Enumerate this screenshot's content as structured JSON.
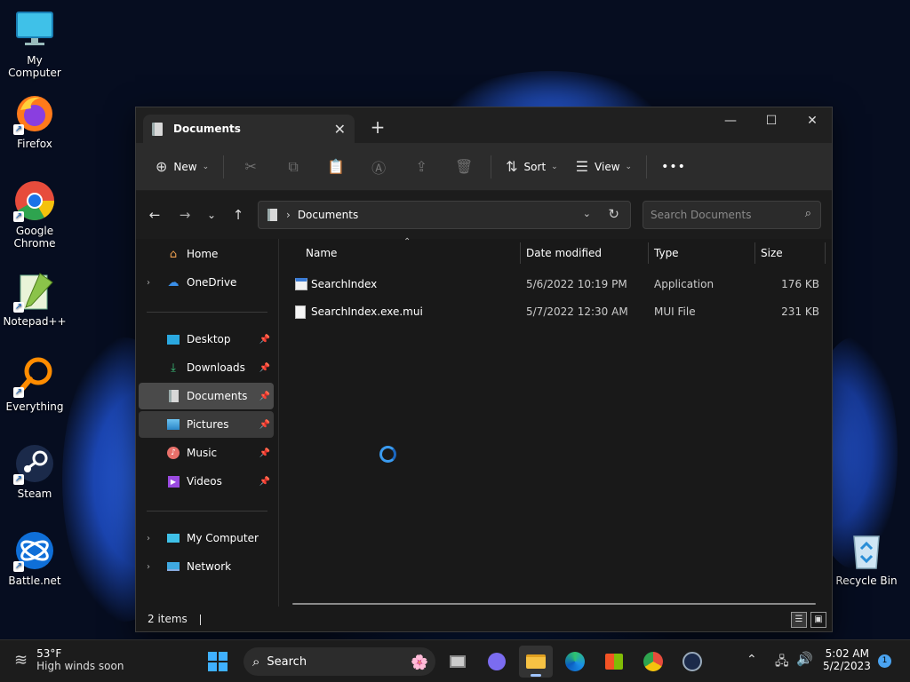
{
  "desktop_icons": [
    {
      "label": "My Computer",
      "icon": "monitor-icon"
    },
    {
      "label": "Firefox",
      "icon": "firefox-icon"
    },
    {
      "label": "Google Chrome",
      "icon": "chrome-icon"
    },
    {
      "label": "Notepad++",
      "icon": "notepadpp-icon"
    },
    {
      "label": "Everything",
      "icon": "everything-icon"
    },
    {
      "label": "Steam",
      "icon": "steam-icon"
    },
    {
      "label": "Battle.net",
      "icon": "battlenet-icon"
    },
    {
      "label": "Recycle Bin",
      "icon": "recycle-bin-icon"
    }
  ],
  "explorer": {
    "tab_title": "Documents",
    "toolbar": {
      "new_label": "New",
      "sort_label": "Sort",
      "view_label": "View",
      "more_label": "•••"
    },
    "address": {
      "crumb": "Documents",
      "sep": "›"
    },
    "search": {
      "placeholder": "Search Documents"
    },
    "sidebar": {
      "home": "Home",
      "onedrive": "OneDrive",
      "desktop": "Desktop",
      "downloads": "Downloads",
      "documents": "Documents",
      "pictures": "Pictures",
      "music": "Music",
      "videos": "Videos",
      "mycomputer": "My Computer",
      "network": "Network"
    },
    "columns": {
      "name": "Name",
      "date": "Date modified",
      "type": "Type",
      "size": "Size"
    },
    "files": [
      {
        "name": "SearchIndex",
        "date": "5/6/2022 10:19 PM",
        "type": "Application",
        "size": "176 KB"
      },
      {
        "name": "SearchIndex.exe.mui",
        "date": "5/7/2022 12:30 AM",
        "type": "MUI File",
        "size": "231 KB"
      }
    ],
    "status": "2 items"
  },
  "taskbar": {
    "weather_temp": "53°F",
    "weather_desc": "High winds soon",
    "search_label": "Search",
    "time": "5:02 AM",
    "date": "5/2/2023",
    "notification_count": "1"
  },
  "colors": {
    "accent": "#0078d4",
    "folder": "#f6c244"
  }
}
